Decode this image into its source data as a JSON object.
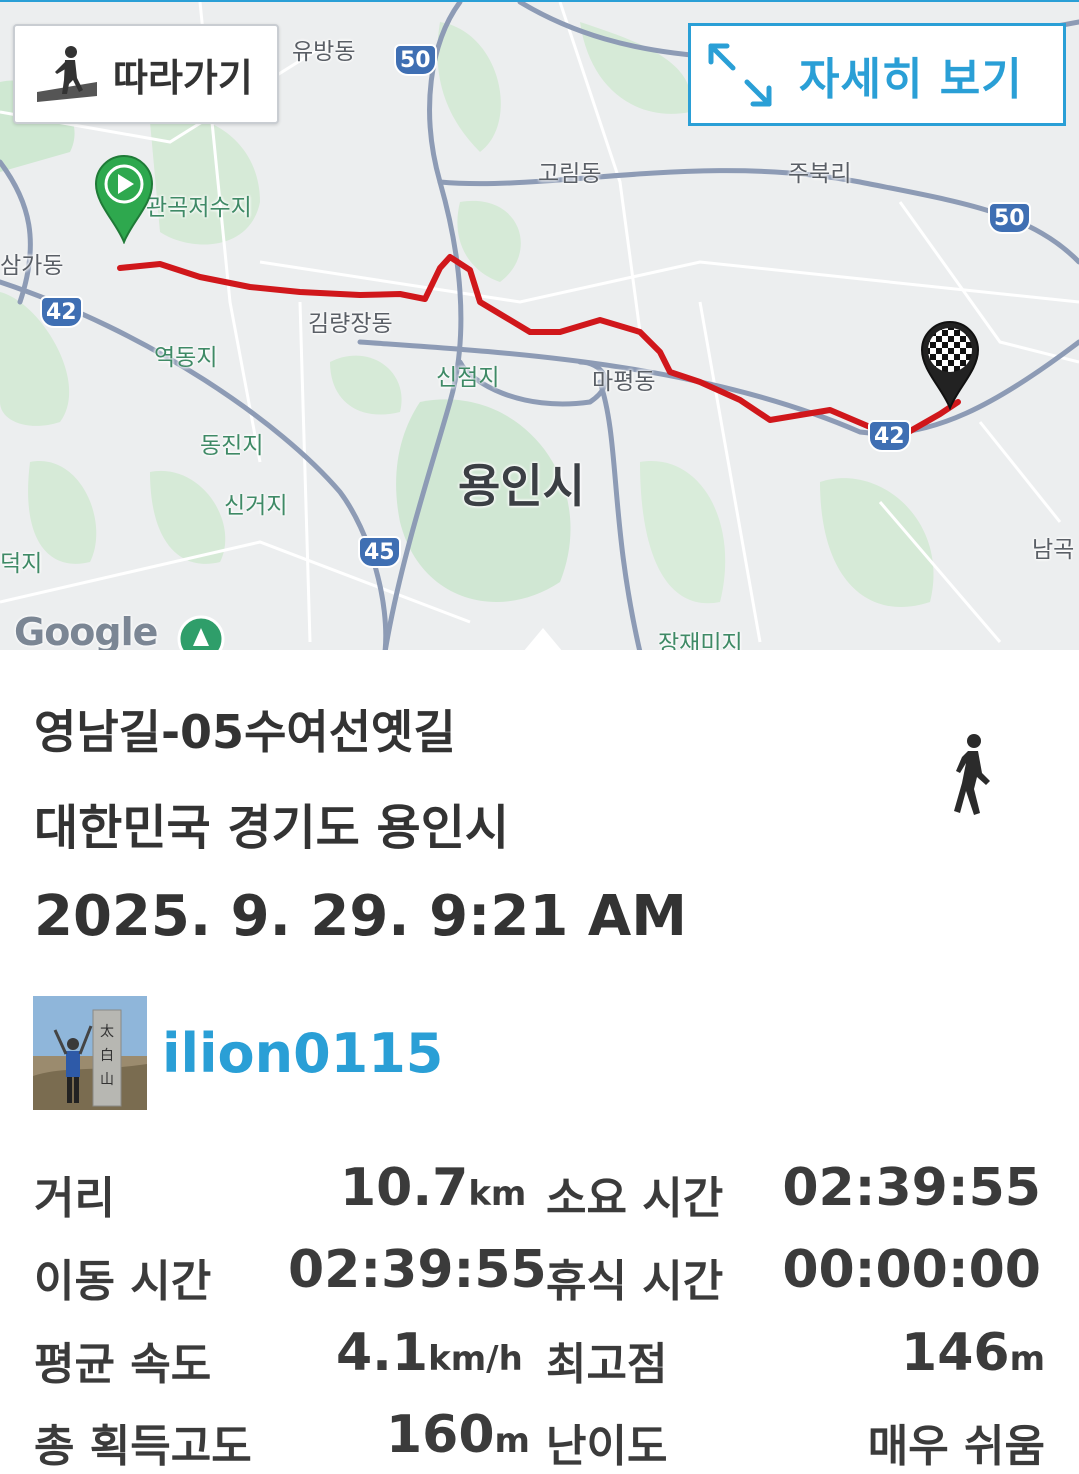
{
  "map": {
    "follow_label": "따라가기",
    "detail_label": "자세히 보기",
    "labels": {
      "yubang": "유방동",
      "gwangok": "관곡저수지",
      "samga": "삼가동",
      "gorim": "고림동",
      "jubuk": "주북리",
      "gimryangjang": "김량장동",
      "yeokdong": "역동지",
      "sinjeom": "신점지",
      "mapyeong": "마평동",
      "dongjin": "동진지",
      "singeo": "신거지",
      "deok": "덕지",
      "city": "용인시",
      "namgok": "남곡",
      "jangjae": "장재미지"
    },
    "shields": {
      "r50_top": "50",
      "r50_right": "50",
      "r42_left": "42",
      "r42_right": "42",
      "r45": "45"
    },
    "google_label": "Google",
    "route_color": "#d0171b",
    "start_marker_color": "#2ea84e",
    "start_marker_icon": "play-icon",
    "end_marker_icon": "checkered-flag-icon"
  },
  "info": {
    "title": "영남길-05수여선옛길",
    "location": "대한민국 경기도 용인시",
    "datetime": "2025. 9. 29. 9:21 AM",
    "activity_icon": "walking-person-icon",
    "username": "ilion0115"
  },
  "stats": {
    "distance": {
      "label": "거리",
      "value": "10.7",
      "unit": "km"
    },
    "duration": {
      "label": "소요 시간",
      "value": "02:39:55"
    },
    "moving_time": {
      "label": "이동 시간",
      "value": "02:39:55"
    },
    "rest_time": {
      "label": "휴식 시간",
      "value": "00:00:00"
    },
    "avg_speed": {
      "label": "평균 속도",
      "value": "4.1",
      "unit": "km/h"
    },
    "max_elevation": {
      "label": "최고점",
      "value": "146",
      "unit": "m"
    },
    "total_ascent": {
      "label": "총 획득고도",
      "value": "160",
      "unit": "m"
    },
    "difficulty": {
      "label": "난이도",
      "value": "매우 쉬움"
    }
  }
}
